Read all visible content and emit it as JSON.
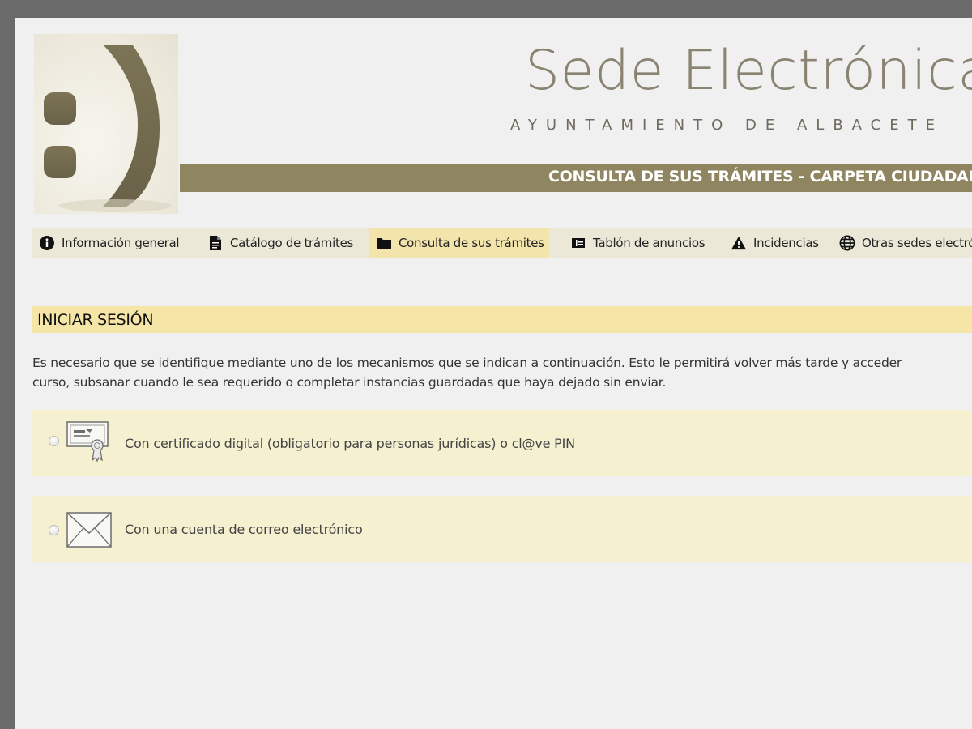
{
  "header": {
    "title": "Sede Electrónica",
    "subtitle": "AYUNTAMIENTO DE ALBACETE",
    "banner": "CONSULTA DE SUS TRÁMITES - CARPETA CIUDADANA"
  },
  "nav": {
    "items": [
      {
        "label": "Información general",
        "icon": "info-icon"
      },
      {
        "label": "Catálogo de trámites",
        "icon": "document-icon"
      },
      {
        "label": "Consulta de sus trámites",
        "icon": "folder-icon",
        "active": true
      },
      {
        "label": "Tablón de anuncios",
        "icon": "board-icon"
      },
      {
        "label": "Incidencias",
        "icon": "warning-icon"
      },
      {
        "label": "Otras sedes electrónicas",
        "icon": "globe-icon"
      }
    ]
  },
  "login": {
    "heading": "INICIAR SESIÓN",
    "intro_line1": " Es necesario que se identifique mediante uno de los mecanismos que se indican a continuación. Esto le permitirá volver más tarde y acceder",
    "intro_line2": "curso, subsanar cuando le sea requerido o completar instancias guardadas que haya dejado sin enviar.",
    "options": [
      {
        "label": "Con certificado digital (obligatorio para personas jurídicas) o cl@ve PIN",
        "icon": "certificate-icon"
      },
      {
        "label": "Con una cuenta de correo electrónico",
        "icon": "envelope-icon"
      }
    ]
  },
  "colors": {
    "accent": "#8f8661",
    "nav_active": "#f3e4ac",
    "heading_bg": "#f5e5a6",
    "option_bg": "#f5f0d0"
  }
}
